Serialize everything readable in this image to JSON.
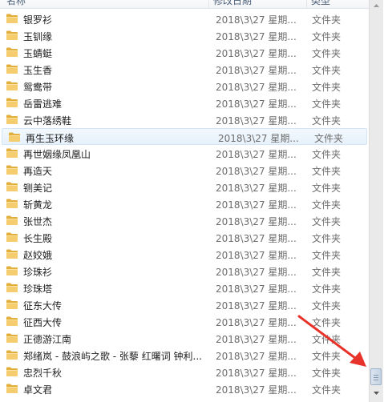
{
  "columns": {
    "name": "名称",
    "date": "修改日期",
    "type": "类型"
  },
  "rows": [
    {
      "name": "银罗衫",
      "date": "2018\\3\\27 星期...",
      "type": "文件夹"
    },
    {
      "name": "玉钏缘",
      "date": "2018\\3\\27 星期...",
      "type": "文件夹"
    },
    {
      "name": "玉蜻蜓",
      "date": "2018\\3\\27 星期...",
      "type": "文件夹"
    },
    {
      "name": "玉生香",
      "date": "2018\\3\\27 星期...",
      "type": "文件夹"
    },
    {
      "name": "鸳鸯带",
      "date": "2018\\3\\27 星期...",
      "type": "文件夹"
    },
    {
      "name": "岳雷逃难",
      "date": "2018\\3\\27 星期...",
      "type": "文件夹"
    },
    {
      "name": "云中落绣鞋",
      "date": "2018\\3\\27 星期...",
      "type": "文件夹"
    },
    {
      "name": "再生玉环缘",
      "date": "2018\\3\\27 星期...",
      "type": "文件夹",
      "selected": true
    },
    {
      "name": "再世姻缘凤凰山",
      "date": "2018\\3\\27 星期...",
      "type": "文件夹"
    },
    {
      "name": "再造天",
      "date": "2018\\3\\27 星期...",
      "type": "文件夹"
    },
    {
      "name": "铡美记",
      "date": "2018\\3\\27 星期...",
      "type": "文件夹"
    },
    {
      "name": "斩黄龙",
      "date": "2018\\3\\27 星期...",
      "type": "文件夹"
    },
    {
      "name": "张世杰",
      "date": "2018\\3\\27 星期...",
      "type": "文件夹"
    },
    {
      "name": "长生殿",
      "date": "2018\\3\\27 星期...",
      "type": "文件夹"
    },
    {
      "name": "赵姣娥",
      "date": "2018\\3\\27 星期...",
      "type": "文件夹"
    },
    {
      "name": "珍珠衫",
      "date": "2018\\3\\27 星期...",
      "type": "文件夹"
    },
    {
      "name": "珍珠塔",
      "date": "2018\\3\\27 星期...",
      "type": "文件夹"
    },
    {
      "name": "征东大传",
      "date": "2018\\3\\27 星期...",
      "type": "文件夹"
    },
    {
      "name": "征西大传",
      "date": "2018\\3\\27 星期...",
      "type": "文件夹"
    },
    {
      "name": "正德游江南",
      "date": "2018\\3\\27 星期...",
      "type": "文件夹"
    },
    {
      "name": "郑绪岚 - 鼓浪屿之歌 - 张藜 红曙词 钟利...",
      "date": "2018\\3\\27 星期...",
      "type": "文件夹"
    },
    {
      "name": "忠烈千秋",
      "date": "2018\\3\\27 星期...",
      "type": "文件夹"
    },
    {
      "name": "卓文君",
      "date": "2018\\3\\27 星期...",
      "type": "文件夹"
    }
  ],
  "scrollbar": {
    "position_fraction": 0.98
  },
  "colors": {
    "folder": "#e8b84a",
    "selection": "#e5f0fb",
    "arrow": "#e8332b"
  },
  "icons": {
    "folder": "folder-icon",
    "scroll_up": "scroll-up-arrow-icon",
    "scroll_down": "scroll-down-arrow-icon"
  }
}
